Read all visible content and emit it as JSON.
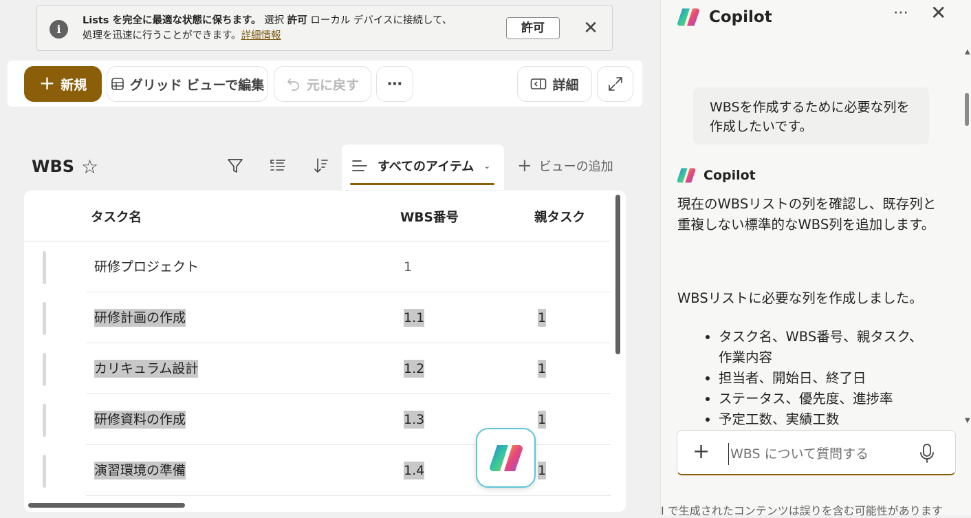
{
  "banner": {
    "line1_bold": "Lists を完全に最適な状態に保ちます。",
    "line1_a": " 選択 ",
    "line1_allow": "許可",
    "line1_b": " ローカル デバイスに接続して、",
    "line2": "処理を迅速に行うことができます。",
    "link": "詳細情報",
    "allow_button": "許可",
    "close": "✕"
  },
  "toolbar": {
    "new": "新規",
    "grid_edit": "グリッド ビューで編集",
    "undo": "元に戻す",
    "more": "⋯",
    "details": "詳細"
  },
  "list": {
    "title": "WBS",
    "view_name": "すべてのアイテム",
    "add_view": "ビューの追加",
    "columns": [
      "タスク名",
      "WBS番号",
      "親タスク"
    ],
    "rows": [
      {
        "name": "研修プロジェクト",
        "wbs": "1",
        "parent": ""
      },
      {
        "name": "研修計画の作成",
        "wbs": "1.1",
        "parent": "1"
      },
      {
        "name": "カリキュラム設計",
        "wbs": "1.2",
        "parent": "1"
      },
      {
        "name": "研修資料の作成",
        "wbs": "1.3",
        "parent": "1"
      },
      {
        "name": "演習環境の準備",
        "wbs": "1.4",
        "parent": "1"
      }
    ]
  },
  "copilot": {
    "title": "Copilot",
    "more": "⋯",
    "close": "✕",
    "user_message": "WBSを作成するために必要な列を作成したいです。",
    "assistant_name": "Copilot",
    "reply_1": "現在のWBSリストの列を確認し、既存列と重複しない標準的なWBS列を追加します。",
    "reply_2": "WBSリストに必要な列を作成しました。",
    "bullets": [
      "タスク名、WBS番号、親タスク、作業内容",
      "担当者、開始日、終了日",
      "ステータス、優先度、進捗率",
      "予定工数、実績工数"
    ],
    "input_placeholder": "WBS について質問する",
    "disclaimer": "I で生成されたコンテンツは誤りを含む可能性があります"
  },
  "colors": {
    "accent": "#8b5e0a",
    "fab_border": "#5bc6d6"
  }
}
